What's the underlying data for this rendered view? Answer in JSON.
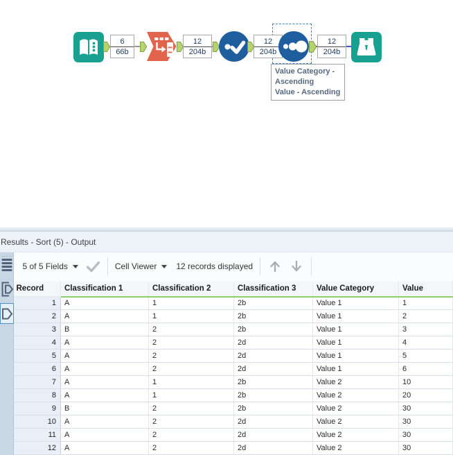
{
  "workflow": {
    "tools": [
      {
        "id": "input-data"
      },
      {
        "id": "transpose"
      },
      {
        "id": "unique"
      },
      {
        "id": "sort"
      },
      {
        "id": "browse"
      }
    ],
    "badges": [
      {
        "count": "6",
        "bytes": "66b"
      },
      {
        "count": "12",
        "bytes": "204b"
      },
      {
        "count": "12",
        "bytes": "204b"
      },
      {
        "count": "12",
        "bytes": "204b"
      }
    ],
    "annotation_lines": [
      "Value Category -",
      "Ascending",
      "Value - Ascending"
    ]
  },
  "results": {
    "title": "Results - Sort (5) - Output",
    "toolbar": {
      "fields_label": "5 of 5 Fields",
      "cell_viewer_label": "Cell Viewer",
      "records_label": "12 records displayed"
    },
    "table": {
      "columns": [
        "Record",
        "Classification 1",
        "Classification 2",
        "Classification 3",
        "Value Category",
        "Value"
      ],
      "rows": [
        [
          "1",
          "A",
          "1",
          "2b",
          "Value 1",
          "1"
        ],
        [
          "2",
          "A",
          "1",
          "2b",
          "Value 1",
          "2"
        ],
        [
          "3",
          "B",
          "2",
          "2b",
          "Value 1",
          "3"
        ],
        [
          "4",
          "A",
          "2",
          "2d",
          "Value 1",
          "4"
        ],
        [
          "5",
          "A",
          "2",
          "2d",
          "Value 1",
          "5"
        ],
        [
          "6",
          "A",
          "2",
          "2d",
          "Value 1",
          "6"
        ],
        [
          "7",
          "A",
          "1",
          "2b",
          "Value 2",
          "10"
        ],
        [
          "8",
          "A",
          "1",
          "2b",
          "Value 2",
          "20"
        ],
        [
          "9",
          "B",
          "2",
          "2b",
          "Value 2",
          "30"
        ],
        [
          "10",
          "A",
          "2",
          "2d",
          "Value 2",
          "30"
        ],
        [
          "11",
          "A",
          "2",
          "2d",
          "Value 2",
          "30"
        ],
        [
          "12",
          "A",
          "2",
          "2d",
          "Value 2",
          "30"
        ]
      ]
    }
  },
  "colors": {
    "tool_teal": "#18a091",
    "tool_orange": "#e0654c",
    "tool_blue": "#1e5d9e",
    "anchor_green": "#b5d36e",
    "selection_blue": "#3a87c8",
    "header_underline": "#8bd16b"
  }
}
